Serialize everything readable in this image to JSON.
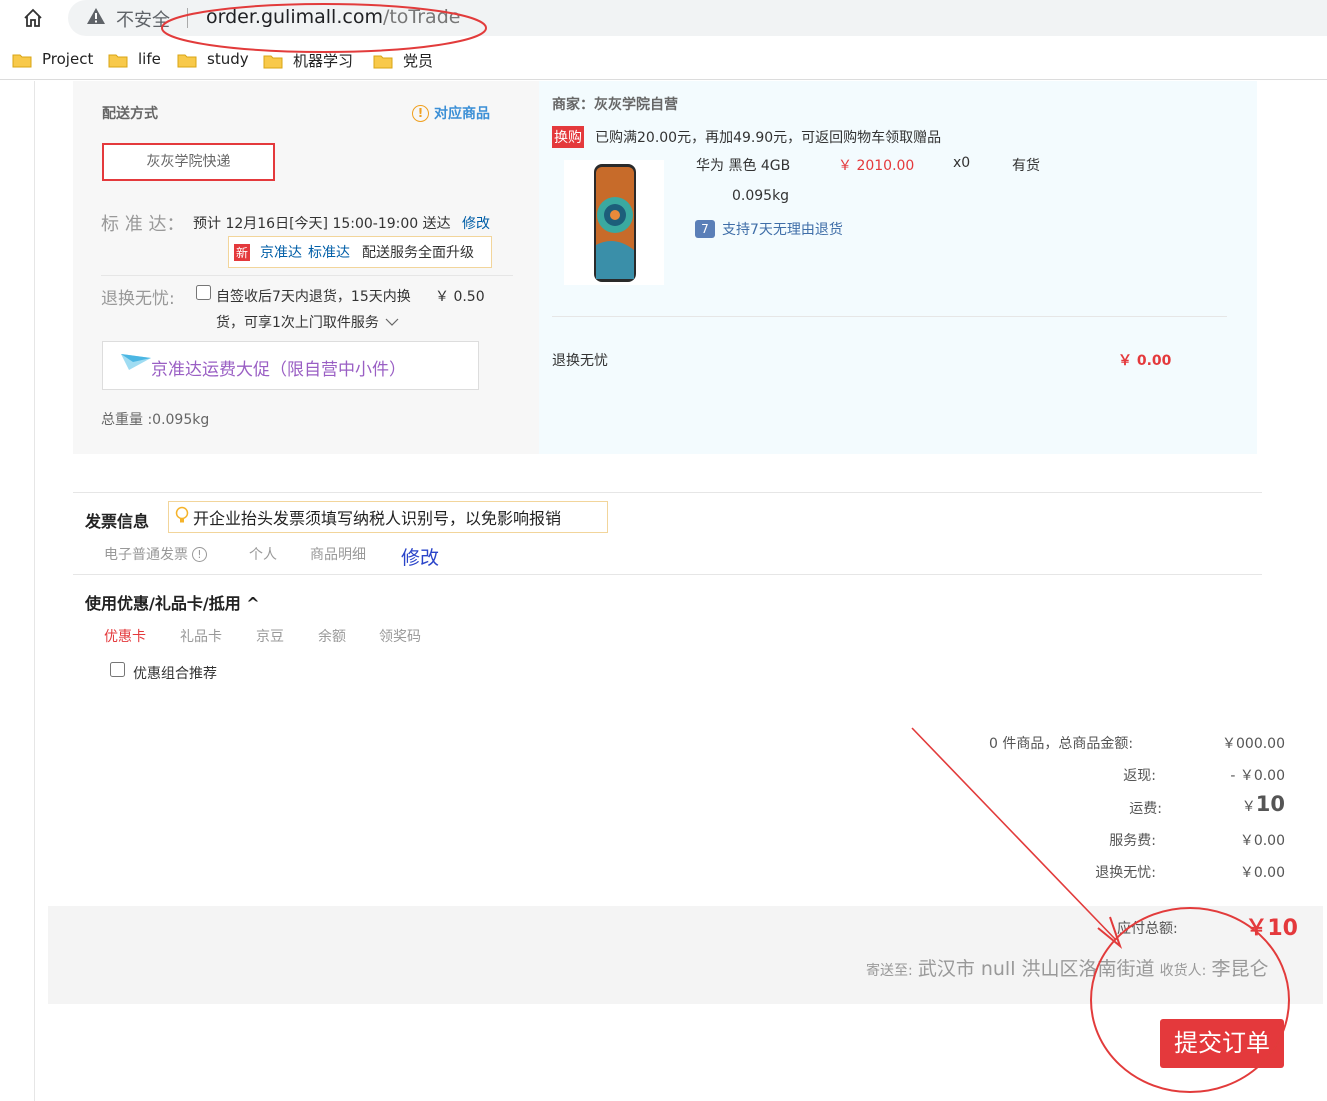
{
  "browser": {
    "security_label": "不安全",
    "url_host": "order.gulimall.com",
    "url_path": "/toTrade",
    "bookmarks": [
      "Project",
      "life",
      "study",
      "机器学习",
      "党员"
    ]
  },
  "shipping": {
    "title": "配送方式",
    "matching_goods": "对应商品",
    "courier_option": "灰灰学院快递",
    "standard_label": "标 准 达：",
    "estimate": "预计 12月16日[今天] 15:00-19:00 送达",
    "modify": "修改",
    "new_badge": "新",
    "jzd_link": "京准达",
    "bzd_link": "标准达",
    "upgrade_text": "配送服务全面升级",
    "return_label": "退换无忧:",
    "return_desc_1": "自签收后7天内退货，15天内换",
    "return_price": "￥ 0.50",
    "return_desc_2": "货，可享1次上门取件服务",
    "promo": "京准达运费大促（限自营中小件）",
    "total_weight": "总重量 :0.095kg"
  },
  "merchant": {
    "label": "商家：灰灰学院自营",
    "swap_badge": "换购",
    "swap_text": "已购满20.00元，再加49.90元，可返回购物车领取赠品",
    "product_name": "华为 黑色 4GB",
    "product_price": "￥ 2010.00",
    "product_qty": "x0",
    "stock": "有货",
    "weight": "0.095kg",
    "return_support": "支持7天无理由退货",
    "seven_icon": "7",
    "return_worry": "退换无忧",
    "return_worry_price": "￥ 0.00"
  },
  "invoice": {
    "title": "发票信息",
    "tip": "开企业抬头发票须填写纳税人识别号，以免影响报销",
    "type": "电子普通发票",
    "person": "个人",
    "detail": "商品明细",
    "modify": "修改"
  },
  "coupon": {
    "title": "使用优惠/礼品卡/抵用 ^",
    "tabs": [
      "优惠卡",
      "礼品卡",
      "京豆",
      "余额",
      "领奖码"
    ],
    "combo": "优惠组合推荐"
  },
  "summary": {
    "rows": [
      {
        "label": "0 件商品，总商品金额:",
        "value": "￥000.00"
      },
      {
        "label": "返现:",
        "value": "- ￥0.00"
      },
      {
        "label": "运费:",
        "value_prefix": "￥",
        "value_big": "10"
      },
      {
        "label": "服务费:",
        "value": "￥0.00"
      },
      {
        "label": "退换无忧:",
        "value": "￥0.00"
      }
    ],
    "payable_label": "应付总额:",
    "payable_value": "￥10",
    "ship_to_label": "寄送至:",
    "ship_to_addr": "武汉市 null 洪山区洛南街道",
    "receiver_label": "收货人:",
    "receiver_name": "李昆仑",
    "submit": "提交订单"
  },
  "colors": {
    "accent_red": "#e4393c",
    "link_blue": "#005ea7",
    "annotation_red": "#e23b3b"
  }
}
